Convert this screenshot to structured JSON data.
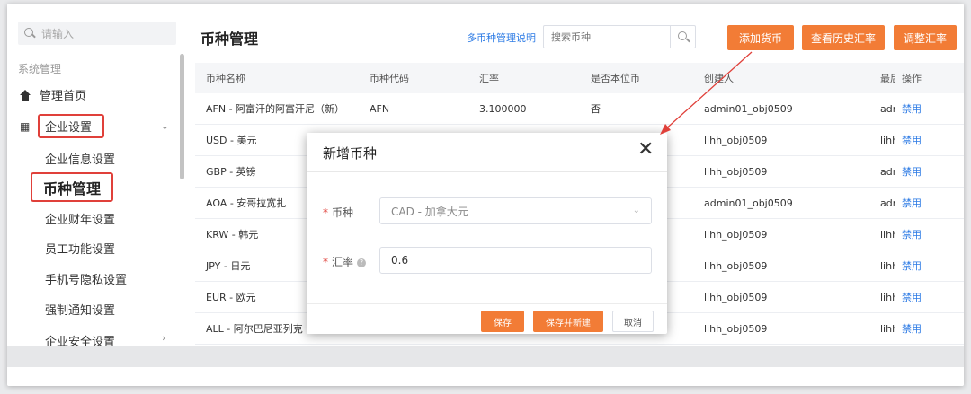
{
  "sidebar": {
    "search_placeholder": "请输入",
    "group_title": "系统管理",
    "home_label": "管理首页",
    "company_settings_label": "企业设置",
    "items": [
      {
        "label": "企业信息设置"
      },
      {
        "label": "币种管理"
      },
      {
        "label": "企业财年设置"
      },
      {
        "label": "员工功能设置"
      },
      {
        "label": "手机号隐私设置"
      },
      {
        "label": "强制通知设置"
      },
      {
        "label": "企业安全设置"
      }
    ]
  },
  "header": {
    "title": "币种管理",
    "help_link": "多币种管理说明",
    "search_placeholder": "搜索币种",
    "add_currency": "添加货币",
    "history_rate": "查看历史汇率",
    "adjust_rate": "调整汇率"
  },
  "table": {
    "columns": [
      "币种名称",
      "币种代码",
      "汇率",
      "是否本位币",
      "创建人",
      "最后",
      "操作"
    ],
    "rows": [
      {
        "name": "AFN - 阿富汗的阿富汗尼（新）",
        "code": "AFN",
        "rate": "3.100000",
        "base": "否",
        "creator": "admin01_obj0509",
        "last": "admi",
        "action": "禁用"
      },
      {
        "name": "USD - 美元",
        "code": "",
        "rate": "",
        "base": "",
        "creator": "lihh_obj0509",
        "last": "lihh_",
        "action": "禁用"
      },
      {
        "name": "GBP - 英镑",
        "code": "",
        "rate": "",
        "base": "",
        "creator": "lihh_obj0509",
        "last": "admi",
        "action": "禁用"
      },
      {
        "name": "AOA - 安哥拉宽扎",
        "code": "",
        "rate": "",
        "base": "",
        "creator": "admin01_obj0509",
        "last": "admi",
        "action": "禁用"
      },
      {
        "name": "KRW - 韩元",
        "code": "",
        "rate": "",
        "base": "",
        "creator": "lihh_obj0509",
        "last": "lihh_",
        "action": "禁用"
      },
      {
        "name": "JPY - 日元",
        "code": "",
        "rate": "",
        "base": "",
        "creator": "lihh_obj0509",
        "last": "lihh_",
        "action": "禁用"
      },
      {
        "name": "EUR - 欧元",
        "code": "",
        "rate": "",
        "base": "",
        "creator": "lihh_obj0509",
        "last": "lihh_",
        "action": "禁用"
      },
      {
        "name": "ALL - 阿尔巴尼亚列克",
        "code": "",
        "rate": "",
        "base": "",
        "creator": "lihh_obj0509",
        "last": "lihh_",
        "action": "禁用"
      }
    ]
  },
  "modal": {
    "title": "新增币种",
    "currency_label": "币种",
    "currency_value": "CAD - 加拿大元",
    "rate_label": "汇率",
    "rate_value": "0.6",
    "save": "保存",
    "save_new": "保存并新建",
    "cancel": "取消"
  },
  "colors": {
    "accent": "#f27c36",
    "link": "#2d7be5",
    "highlight": "#e0403a"
  }
}
